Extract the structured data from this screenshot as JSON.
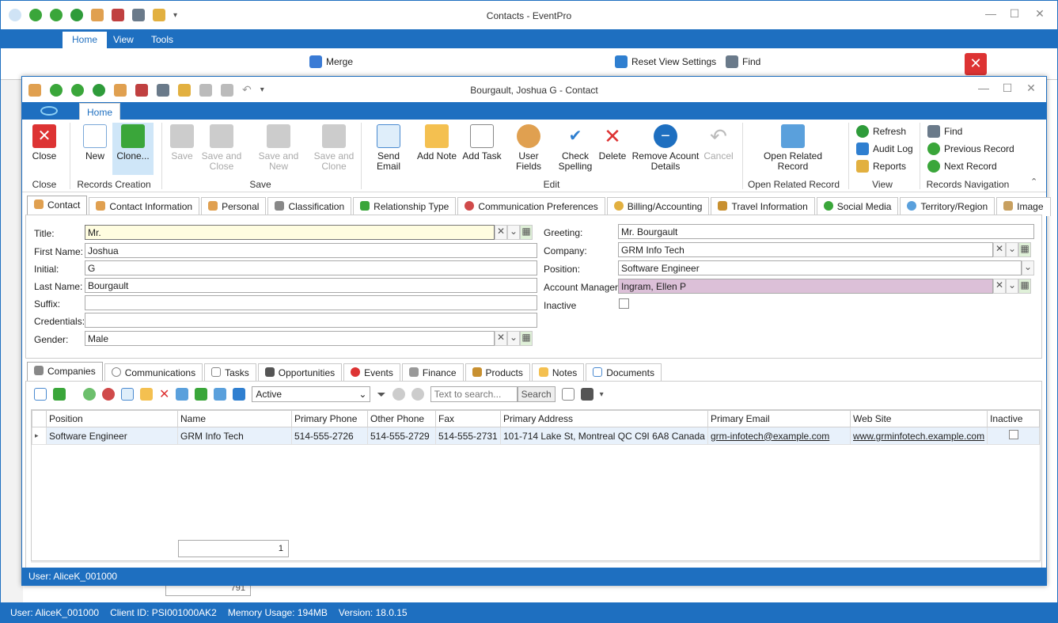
{
  "outer": {
    "title": "Contacts - EventPro",
    "tabs": [
      "Home",
      "View",
      "Tools"
    ],
    "ribbon_items": {
      "merge": "Merge",
      "delete": "Delete",
      "reset_view": "Reset View Settings",
      "audit_log": "Audit Log",
      "find": "Find",
      "previous_record": "Previous Record"
    },
    "bg_count": "791"
  },
  "inner": {
    "title": "Bourgault, Joshua G - Contact",
    "tab_home": "Home",
    "ribbon": {
      "close": "Close",
      "new": "New",
      "clone": "Clone...",
      "save": "Save",
      "save_close": "Save and Close",
      "save_new": "Save and New",
      "save_clone": "Save and Clone",
      "send_email": "Send Email",
      "add_note": "Add Note",
      "add_task": "Add Task",
      "user_fields": "User Fields",
      "check_spelling": "Check Spelling",
      "delete": "Delete",
      "remove_account": "Remove Acount Details",
      "cancel": "Cancel",
      "open_related": "Open Related Record",
      "refresh": "Refresh",
      "audit_log": "Audit Log",
      "reports": "Reports",
      "find": "Find",
      "previous_record": "Previous Record",
      "next_record": "Next Record",
      "groups": {
        "close": "Close",
        "records_creation": "Records Creation",
        "save": "Save",
        "edit": "Edit",
        "open_related": "Open Related Record",
        "view": "View",
        "records_navigation": "Records Navigation"
      }
    },
    "tabs": [
      "Contact",
      "Contact Information",
      "Personal",
      "Classification",
      "Relationship Type",
      "Communication Preferences",
      "Billing/Accounting",
      "Travel Information",
      "Social Media",
      "Territory/Region",
      "Image"
    ],
    "form": {
      "title_label": "Title:",
      "title_value": "Mr.",
      "first_label": "First Name:",
      "first_value": "Joshua",
      "initial_label": "Initial:",
      "initial_value": "G",
      "last_label": "Last Name:",
      "last_value": "Bourgault",
      "suffix_label": "Suffix:",
      "suffix_value": "",
      "credentials_label": "Credentials:",
      "credentials_value": "",
      "gender_label": "Gender:",
      "gender_value": "Male",
      "greeting_label": "Greeting:",
      "greeting_value": "Mr. Bourgault",
      "company_label": "Company:",
      "company_value": "GRM Info Tech",
      "position_label": "Position:",
      "position_value": "Software Engineer",
      "manager_label": "Account Manager:",
      "manager_value": "Ingram, Ellen P",
      "inactive_label": "Inactive"
    },
    "sub_tabs": [
      "Companies",
      "Communications",
      "Tasks",
      "Opportunities",
      "Events",
      "Finance",
      "Products",
      "Notes",
      "Documents"
    ],
    "grid": {
      "filter_value": "Active",
      "search_placeholder": "Text to search...",
      "search_button": "Search",
      "columns": [
        "Position",
        "Name",
        "Primary Phone",
        "Other Phone",
        "Fax",
        "Primary Address",
        "Primary Email",
        "Web Site",
        "Inactive"
      ],
      "rows": [
        [
          "Software Engineer",
          "GRM Info Tech",
          "514-555-2726",
          "514-555-2729",
          "514-555-2731",
          "101-714 Lake St, Montreal QC C9I 6A8 Canada",
          "grm-infotech@example.com",
          "www.grminfotech.example.com",
          ""
        ]
      ],
      "count": "1"
    },
    "status_user": "User: AliceK_001000"
  },
  "statusbar": {
    "user": "User: AliceK_001000",
    "client": "Client ID: PSI001000AK2",
    "memory": "Memory Usage: 194MB",
    "version": "Version: 18.0.15"
  },
  "colors": {
    "accent": "#1e6fc0",
    "manager_bg": "#dcc0d8",
    "title_bg": "#fffde0"
  }
}
